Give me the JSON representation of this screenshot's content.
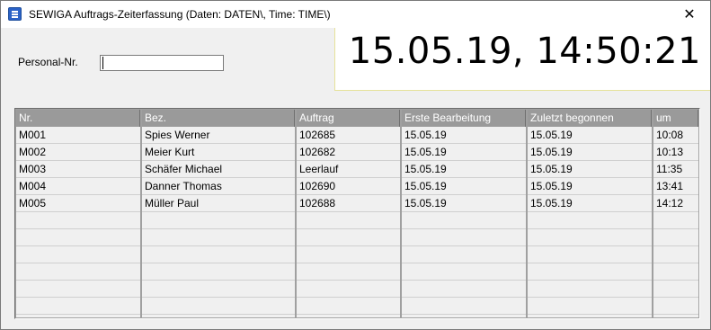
{
  "window": {
    "title": "SEWIGA Auftrags-Zeiterfassung (Daten: DATEN\\, Time: TIME\\)",
    "close_glyph": "✕"
  },
  "personal": {
    "label": "Personal-Nr.",
    "value": ""
  },
  "clock": {
    "text": "15.05.19, 14:50:21"
  },
  "table": {
    "columns": [
      "Nr.",
      "Bez.",
      "Auftrag",
      "Erste Bearbeitung",
      "Zuletzt begonnen",
      "um"
    ],
    "rows": [
      [
        "M001",
        "Spies Werner",
        "102685",
        "15.05.19",
        "15.05.19",
        "10:08"
      ],
      [
        "M002",
        "Meier Kurt",
        "102682",
        "15.05.19",
        "15.05.19",
        "10:13"
      ],
      [
        "M003",
        "Schäfer Michael",
        "Leerlauf",
        "15.05.19",
        "15.05.19",
        "11:35"
      ],
      [
        "M004",
        "Danner Thomas",
        "102690",
        "15.05.19",
        "15.05.19",
        "13:41"
      ],
      [
        "M005",
        "Müller Paul",
        "102688",
        "15.05.19",
        "15.05.19",
        "14:12"
      ],
      [
        "",
        "",
        "",
        "",
        "",
        ""
      ],
      [
        "",
        "",
        "",
        "",
        "",
        ""
      ],
      [
        "",
        "",
        "",
        "",
        "",
        ""
      ],
      [
        "",
        "",
        "",
        "",
        "",
        ""
      ],
      [
        "",
        "",
        "",
        "",
        "",
        ""
      ],
      [
        "",
        "",
        "",
        "",
        "",
        ""
      ]
    ]
  }
}
